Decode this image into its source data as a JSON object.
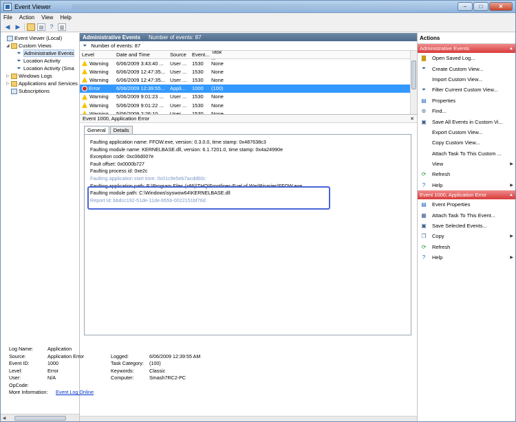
{
  "window": {
    "title": "Event Viewer",
    "min": "–",
    "max": "□",
    "close": "✕"
  },
  "menu": [
    "File",
    "Action",
    "View",
    "Help"
  ],
  "tree": {
    "items": [
      {
        "label": "Event Viewer (Local)",
        "level": 0,
        "arrow": ""
      },
      {
        "label": "Custom Views",
        "level": 1,
        "arrow": "◢"
      },
      {
        "label": "Administrative Events",
        "level": 2,
        "arrow": ""
      },
      {
        "label": "Location Activity",
        "level": 2,
        "arrow": ""
      },
      {
        "label": "Location Activity (Sma",
        "level": 2,
        "arrow": ""
      },
      {
        "label": "Windows Logs",
        "level": 1,
        "arrow": "▷"
      },
      {
        "label": "Applications and Services",
        "level": 1,
        "arrow": "▷"
      },
      {
        "label": "Subscriptions",
        "level": 1,
        "arrow": ""
      }
    ]
  },
  "header": {
    "title": "Administrative Events",
    "count_label": "Number of events: 87"
  },
  "filter": {
    "text": "Number of events: 87"
  },
  "grid": {
    "columns": [
      "Level",
      "Date and Time",
      "Source",
      "Event...",
      "Task ..."
    ],
    "rows": [
      {
        "level": "Warning",
        "date": "6/06/2009 3:43:40 ...",
        "source": "User ...",
        "event": "1530",
        "task": "None",
        "type": "warning"
      },
      {
        "level": "Warning",
        "date": "6/06/2009 12:47:35...",
        "source": "User ...",
        "event": "1530",
        "task": "None",
        "type": "warning"
      },
      {
        "level": "Warning",
        "date": "6/06/2009 12:47:35...",
        "source": "User ...",
        "event": "1530",
        "task": "None",
        "type": "warning"
      },
      {
        "level": "Error",
        "date": "6/06/2009 12:39:55...",
        "source": "Appli...",
        "event": "1000",
        "task": "(100)",
        "type": "error",
        "selected": true
      },
      {
        "level": "Warning",
        "date": "5/06/2009 9:01:23 ...",
        "source": "User ...",
        "event": "1530",
        "task": "None",
        "type": "warning"
      },
      {
        "level": "Warning",
        "date": "5/06/2009 9:01:22 ...",
        "source": "User ...",
        "event": "1530",
        "task": "None",
        "type": "warning"
      },
      {
        "level": "Warning",
        "date": "5/06/2009 2:26:10 ...",
        "source": "User ...",
        "event": "1530",
        "task": "None",
        "type": "warning"
      }
    ]
  },
  "detail": {
    "title": "Event 1000, Application Error",
    "tabs": [
      "General",
      "Details"
    ],
    "lines": [
      "Faulting application name: FFOW.exe, version: 0.3.0.0, time stamp: 0x487638c3",
      "Faulting module name: KERNELBASE.dll, version: 6.1.7201.0, time stamp: 0x4a24990e",
      "Exception code: 0xc06d007e",
      "Fault offset: 0x0000b727",
      "Faulting process id: 0xe2c",
      "Faulting application start time: 0x01c9e5eb7acdd60c",
      "Faulting application path: E:\\Program Files (x86)\\THQ\\Frontlines-Fuel of War\\Binaries\\FFOW.exe",
      "Faulting module path: C:\\Windows\\syswow64\\KERNELBASE.dll",
      "Report Id: bbdcc192-51de-11de-b556-0022151bf76d"
    ],
    "props": {
      "log_name_k": "Log Name:",
      "log_name_v": "Application",
      "source_k": "Source:",
      "source_v": "Application Error",
      "logged_k": "Logged:",
      "logged_v": "6/06/2009 12:39:55 AM",
      "event_id_k": "Event ID:",
      "event_id_v": "1000",
      "task_cat_k": "Task Category:",
      "task_cat_v": "(100)",
      "level_k": "Level:",
      "level_v": "Error",
      "keywords_k": "Keywords:",
      "keywords_v": "Classic",
      "user_k": "User:",
      "user_v": "N/A",
      "computer_k": "Computer:",
      "computer_v": "Smash7RC2-PC",
      "opcode_k": "OpCode:",
      "opcode_v": "",
      "more_k": "More Information:",
      "more_v": "Event Log Online"
    }
  },
  "actions": {
    "title": "Actions",
    "section1": {
      "title": "Administrative Events",
      "items": [
        {
          "label": "Open Saved Log...",
          "icon": "folder-icon",
          "sub": false
        },
        {
          "label": "Create Custom View...",
          "icon": "filter-plus-icon",
          "sub": false
        },
        {
          "label": "Import Custom View...",
          "icon": "",
          "sub": false
        },
        {
          "label": "Filter Current Custom View...",
          "icon": "filter-icon",
          "sub": false
        },
        {
          "label": "Properties",
          "icon": "properties-icon",
          "sub": false
        },
        {
          "label": "Find...",
          "icon": "binoculars-icon",
          "sub": false
        },
        {
          "label": "Save All Events in Custom Vi...",
          "icon": "save-icon",
          "sub": false
        },
        {
          "label": "Export Custom View...",
          "icon": "",
          "sub": false
        },
        {
          "label": "Copy Custom View...",
          "icon": "",
          "sub": false
        },
        {
          "label": "Attach Task To This Custom ...",
          "icon": "",
          "sub": false
        },
        {
          "label": "View",
          "icon": "",
          "sub": true
        },
        {
          "label": "Refresh",
          "icon": "refresh-icon",
          "sub": false
        },
        {
          "label": "Help",
          "icon": "help-icon",
          "sub": true
        }
      ]
    },
    "section2": {
      "title": "Event 1000, Application Error",
      "items": [
        {
          "label": "Event Properties",
          "icon": "properties-icon",
          "sub": false
        },
        {
          "label": "Attach Task To This Event...",
          "icon": "task-icon",
          "sub": false
        },
        {
          "label": "Save Selected Events...",
          "icon": "save-icon",
          "sub": false
        },
        {
          "label": "Copy",
          "icon": "copy-icon",
          "sub": true
        },
        {
          "label": "Refresh",
          "icon": "refresh-icon",
          "sub": false
        },
        {
          "label": "Help",
          "icon": "help-icon",
          "sub": true
        }
      ]
    }
  }
}
